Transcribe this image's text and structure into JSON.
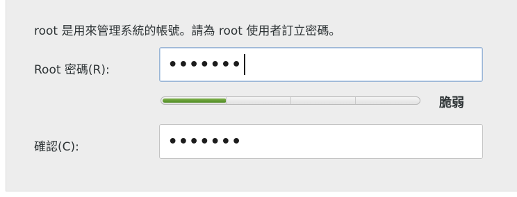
{
  "intro_text": "root 是用來管理系統的帳號。請為 root 使用者訂立密碼。",
  "password": {
    "label": "Root 密碼(R):",
    "masked_value": "•••••••",
    "focused": true
  },
  "strength": {
    "fraction": 0.25,
    "label": "脆弱",
    "fill_color": "#4e8a22"
  },
  "confirm": {
    "label": "確認(C):",
    "masked_value": "•••••••"
  },
  "colors": {
    "panel_bg": "#ededed",
    "focus_border": "#9bb6d6"
  }
}
